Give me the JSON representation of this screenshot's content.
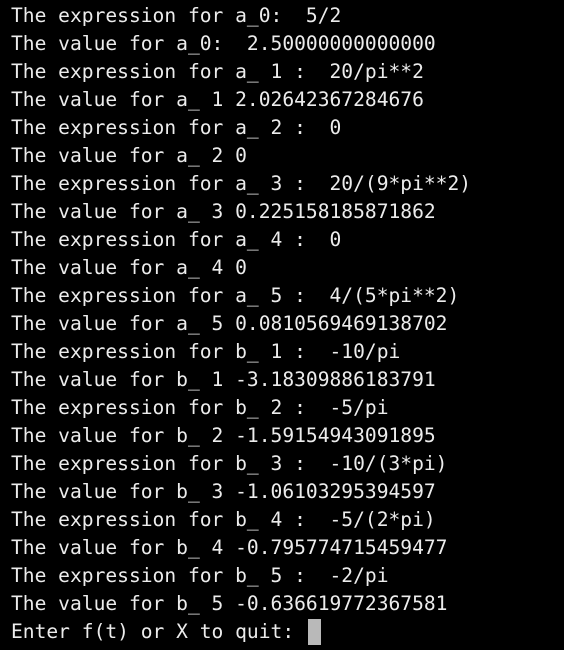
{
  "terminal": {
    "lines": [
      "The expression for a_0:  5/2",
      "The value for a_0:  2.50000000000000",
      "The expression for a_ 1 :  20/pi**2",
      "The value for a_ 1 2.02642367284676",
      "The expression for a_ 2 :  0",
      "The value for a_ 2 0",
      "The expression for a_ 3 :  20/(9*pi**2)",
      "The value for a_ 3 0.225158185871862",
      "The expression for a_ 4 :  0",
      "The value for a_ 4 0",
      "The expression for a_ 5 :  4/(5*pi**2)",
      "The value for a_ 5 0.0810569469138702",
      "The expression for b_ 1 :  -10/pi",
      "The value for b_ 1 -3.18309886183791",
      "The expression for b_ 2 :  -5/pi",
      "The value for b_ 2 -1.59154943091895",
      "The expression for b_ 3 :  -10/(3*pi)",
      "The value for b_ 3 -1.06103295394597",
      "The expression for b_ 4 :  -5/(2*pi)",
      "The value for b_ 4 -0.795774715459477",
      "The expression for b_ 5 :  -2/pi",
      "The value for b_ 5 -0.636619772367581"
    ],
    "prompt": "Enter f(t) or X to quit: ",
    "input_value": "",
    "colors": {
      "background": "#000000",
      "text": "#ececec",
      "cursor": "#b9b9b9"
    }
  }
}
